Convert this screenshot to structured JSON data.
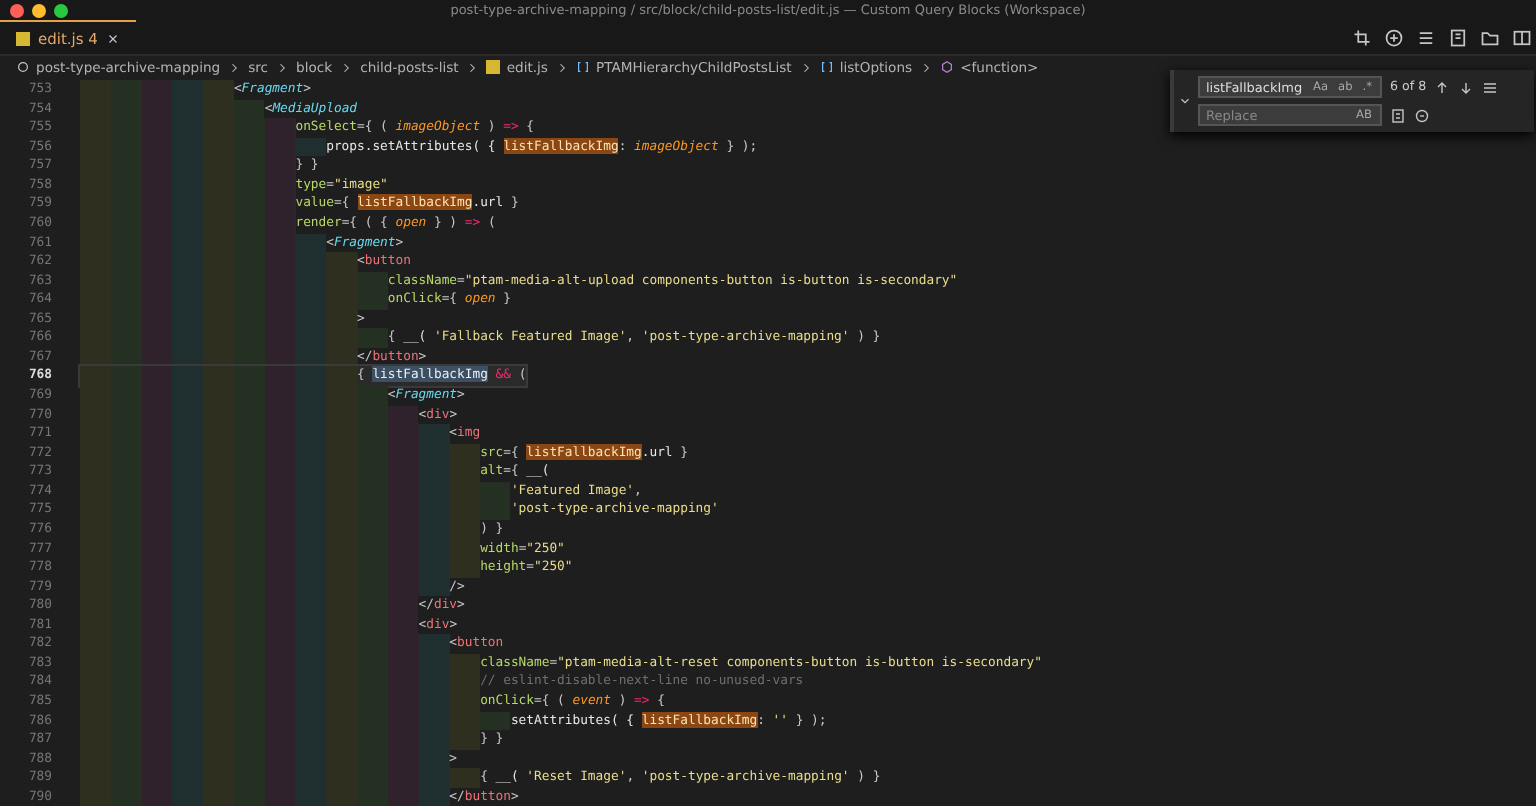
{
  "window": {
    "title": "post-type-archive-mapping / src/block/child-posts-list/edit.js — Custom Query Blocks (Workspace)"
  },
  "tabs": [
    {
      "label": "edit.js",
      "problems": "4",
      "selected": true
    }
  ],
  "breadcrumbs": [
    {
      "kind": "folder",
      "label": "post-type-archive-mapping"
    },
    {
      "kind": "folder",
      "label": "src"
    },
    {
      "kind": "folder",
      "label": "block"
    },
    {
      "kind": "folder",
      "label": "child-posts-list"
    },
    {
      "kind": "file",
      "label": "edit.js"
    },
    {
      "kind": "symbol",
      "label": "PTAMHierarchyChildPostsList"
    },
    {
      "kind": "symbol",
      "label": "listOptions"
    },
    {
      "kind": "function",
      "label": "<function>"
    }
  ],
  "lines": [
    {
      "number": "753",
      "current": false,
      "tokens": [
        {
          "kind": "punct",
          "text": "<"
        },
        {
          "kind": "tag",
          "text": "Fragment"
        },
        {
          "kind": "punct",
          "text": ">"
        }
      ],
      "children": [
        {
          "number": "754",
          "current": false,
          "tokens": [
            {
              "kind": "punct",
              "text": "<"
            },
            {
              "kind": "tag",
              "text": "MediaUpload"
            }
          ],
          "children": [
            {
              "number": "755",
              "current": false,
              "tokens": [
                {
                  "kind": "attr",
                  "text": "onSelect"
                },
                {
                  "kind": "punct",
                  "text": "={ ( "
                },
                {
                  "kind": "param",
                  "text": "imageObject"
                },
                {
                  "kind": "punct",
                  "text": " ) "
                },
                {
                  "kind": "keyword",
                  "text": "=>"
                },
                {
                  "kind": "punct",
                  "text": " {"
                }
              ],
              "children": [
                {
                  "number": "756",
                  "current": false,
                  "tokens": [
                    {
                      "kind": "plain",
                      "text": "props.setAttributes( { "
                    },
                    {
                      "kind": "match",
                      "text": "listFallbackImg"
                    },
                    {
                      "kind": "punct",
                      "text": ": "
                    },
                    {
                      "kind": "param",
                      "text": "imageObject"
                    },
                    {
                      "kind": "punct",
                      "text": " } );"
                    }
                  ]
                }
              ]
            },
            {
              "number": "757",
              "current": false,
              "tokens": [
                {
                  "kind": "punct",
                  "text": "} }"
                }
              ]
            },
            {
              "number": "758",
              "current": false,
              "tokens": [
                {
                  "kind": "attr",
                  "text": "type"
                },
                {
                  "kind": "punct",
                  "text": "="
                },
                {
                  "kind": "string",
                  "text": "\"image\""
                }
              ]
            },
            {
              "number": "759",
              "current": false,
              "tokens": [
                {
                  "kind": "attr",
                  "text": "value"
                },
                {
                  "kind": "punct",
                  "text": "={ "
                },
                {
                  "kind": "match",
                  "text": "listFallbackImg"
                },
                {
                  "kind": "plain",
                  "text": ".url"
                },
                {
                  "kind": "punct",
                  "text": " }"
                }
              ]
            },
            {
              "number": "760",
              "current": false,
              "tokens": [
                {
                  "kind": "attr",
                  "text": "render"
                },
                {
                  "kind": "punct",
                  "text": "={ ( { "
                },
                {
                  "kind": "param",
                  "text": "open"
                },
                {
                  "kind": "punct",
                  "text": " } ) "
                },
                {
                  "kind": "keyword",
                  "text": "=>"
                },
                {
                  "kind": "punct",
                  "text": " ("
                }
              ],
              "children": [
                {
                  "number": "761",
                  "current": false,
                  "tokens": [
                    {
                      "kind": "punct",
                      "text": "<"
                    },
                    {
                      "kind": "tag",
                      "text": "Fragment"
                    },
                    {
                      "kind": "punct",
                      "text": ">"
                    }
                  ],
                  "children": [
                    {
                      "number": "762",
                      "current": false,
                      "tokens": [
                        {
                          "kind": "punct",
                          "text": "<"
                        },
                        {
                          "kind": "element",
                          "text": "button"
                        }
                      ],
                      "children": [
                        {
                          "number": "763",
                          "current": false,
                          "tokens": [
                            {
                              "kind": "attr",
                              "text": "className"
                            },
                            {
                              "kind": "punct",
                              "text": "="
                            },
                            {
                              "kind": "string",
                              "text": "\"ptam-media-alt-upload components-button is-button is-secondary\""
                            }
                          ]
                        },
                        {
                          "number": "764",
                          "current": false,
                          "tokens": [
                            {
                              "kind": "attr",
                              "text": "onClick"
                            },
                            {
                              "kind": "punct",
                              "text": "={ "
                            },
                            {
                              "kind": "param",
                              "text": "open"
                            },
                            {
                              "kind": "punct",
                              "text": " }"
                            }
                          ]
                        }
                      ]
                    },
                    {
                      "number": "765",
                      "current": false,
                      "tokens": [
                        {
                          "kind": "punct",
                          "text": ">"
                        }
                      ],
                      "children": [
                        {
                          "number": "766",
                          "current": false,
                          "tokens": [
                            {
                              "kind": "punct",
                              "text": "{ "
                            },
                            {
                              "kind": "plain",
                              "text": "__( "
                            },
                            {
                              "kind": "string",
                              "text": "'Fallback Featured Image'"
                            },
                            {
                              "kind": "punct",
                              "text": ", "
                            },
                            {
                              "kind": "string",
                              "text": "'post-type-archive-mapping'"
                            },
                            {
                              "kind": "punct",
                              "text": " ) }"
                            }
                          ]
                        }
                      ]
                    },
                    {
                      "number": "767",
                      "current": false,
                      "tokens": [
                        {
                          "kind": "punct",
                          "text": "</"
                        },
                        {
                          "kind": "element",
                          "text": "button"
                        },
                        {
                          "kind": "punct",
                          "text": ">"
                        }
                      ]
                    },
                    {
                      "number": "768",
                      "current": true,
                      "tokens": [
                        {
                          "kind": "punct",
                          "text": "{ "
                        },
                        {
                          "kind": "selection",
                          "text": "listFallbackImg"
                        },
                        {
                          "kind": "keyword",
                          "text": " &&"
                        },
                        {
                          "kind": "punct",
                          "text": " ("
                        }
                      ],
                      "children": [
                        {
                          "number": "769",
                          "current": false,
                          "tokens": [
                            {
                              "kind": "punct",
                              "text": "<"
                            },
                            {
                              "kind": "tag",
                              "text": "Fragment"
                            },
                            {
                              "kind": "punct",
                              "text": ">"
                            }
                          ],
                          "children": [
                            {
                              "number": "770",
                              "current": false,
                              "tokens": [
                                {
                                  "kind": "punct",
                                  "text": "<"
                                },
                                {
                                  "kind": "element",
                                  "text": "div"
                                },
                                {
                                  "kind": "punct",
                                  "text": ">"
                                }
                              ],
                              "children": [
                                {
                                  "number": "771",
                                  "current": false,
                                  "tokens": [
                                    {
                                      "kind": "punct",
                                      "text": "<"
                                    },
                                    {
                                      "kind": "element",
                                      "text": "img"
                                    }
                                  ],
                                  "children": [
                                    {
                                      "number": "772",
                                      "current": false,
                                      "tokens": [
                                        {
                                          "kind": "attr",
                                          "text": "src"
                                        },
                                        {
                                          "kind": "punct",
                                          "text": "={ "
                                        },
                                        {
                                          "kind": "match",
                                          "text": "listFallbackImg"
                                        },
                                        {
                                          "kind": "plain",
                                          "text": ".url"
                                        },
                                        {
                                          "kind": "punct",
                                          "text": " }"
                                        }
                                      ]
                                    },
                                    {
                                      "number": "773",
                                      "current": false,
                                      "tokens": [
                                        {
                                          "kind": "attr",
                                          "text": "alt"
                                        },
                                        {
                                          "kind": "punct",
                                          "text": "={ "
                                        },
                                        {
                                          "kind": "plain",
                                          "text": "__("
                                        }
                                      ],
                                      "children": [
                                        {
                                          "number": "774",
                                          "current": false,
                                          "tokens": [
                                            {
                                              "kind": "string",
                                              "text": "'Featured Image'"
                                            },
                                            {
                                              "kind": "punct",
                                              "text": ","
                                            }
                                          ]
                                        },
                                        {
                                          "number": "775",
                                          "current": false,
                                          "tokens": [
                                            {
                                              "kind": "string",
                                              "text": "'post-type-archive-mapping'"
                                            }
                                          ]
                                        }
                                      ]
                                    },
                                    {
                                      "number": "776",
                                      "current": false,
                                      "tokens": [
                                        {
                                          "kind": "punct",
                                          "text": ") }"
                                        }
                                      ]
                                    },
                                    {
                                      "number": "777",
                                      "current": false,
                                      "tokens": [
                                        {
                                          "kind": "attr",
                                          "text": "width"
                                        },
                                        {
                                          "kind": "punct",
                                          "text": "="
                                        },
                                        {
                                          "kind": "string",
                                          "text": "\"250\""
                                        }
                                      ]
                                    },
                                    {
                                      "number": "778",
                                      "current": false,
                                      "tokens": [
                                        {
                                          "kind": "attr",
                                          "text": "height"
                                        },
                                        {
                                          "kind": "punct",
                                          "text": "="
                                        },
                                        {
                                          "kind": "string",
                                          "text": "\"250\""
                                        }
                                      ]
                                    }
                                  ]
                                },
                                {
                                  "number": "779",
                                  "current": false,
                                  "tokens": [
                                    {
                                      "kind": "punct",
                                      "text": "/>"
                                    }
                                  ]
                                }
                              ]
                            },
                            {
                              "number": "780",
                              "current": false,
                              "tokens": [
                                {
                                  "kind": "punct",
                                  "text": "</"
                                },
                                {
                                  "kind": "element",
                                  "text": "div"
                                },
                                {
                                  "kind": "punct",
                                  "text": ">"
                                }
                              ]
                            },
                            {
                              "number": "781",
                              "current": false,
                              "tokens": [
                                {
                                  "kind": "punct",
                                  "text": "<"
                                },
                                {
                                  "kind": "element",
                                  "text": "div"
                                },
                                {
                                  "kind": "punct",
                                  "text": ">"
                                }
                              ],
                              "children": [
                                {
                                  "number": "782",
                                  "current": false,
                                  "tokens": [
                                    {
                                      "kind": "punct",
                                      "text": "<"
                                    },
                                    {
                                      "kind": "element",
                                      "text": "button"
                                    }
                                  ],
                                  "children": [
                                    {
                                      "number": "783",
                                      "current": false,
                                      "tokens": [
                                        {
                                          "kind": "attr",
                                          "text": "className"
                                        },
                                        {
                                          "kind": "punct",
                                          "text": "="
                                        },
                                        {
                                          "kind": "string",
                                          "text": "\"ptam-media-alt-reset components-button is-button is-secondary\""
                                        }
                                      ]
                                    },
                                    {
                                      "number": "784",
                                      "current": false,
                                      "tokens": [
                                        {
                                          "kind": "comment",
                                          "text": "// eslint-disable-next-line no-unused-vars"
                                        }
                                      ]
                                    },
                                    {
                                      "number": "785",
                                      "current": false,
                                      "tokens": [
                                        {
                                          "kind": "attr",
                                          "text": "onClick"
                                        },
                                        {
                                          "kind": "punct",
                                          "text": "={ ( "
                                        },
                                        {
                                          "kind": "param",
                                          "text": "event"
                                        },
                                        {
                                          "kind": "punct",
                                          "text": " ) "
                                        },
                                        {
                                          "kind": "keyword",
                                          "text": "=>"
                                        },
                                        {
                                          "kind": "punct",
                                          "text": " {"
                                        }
                                      ],
                                      "children": [
                                        {
                                          "number": "786",
                                          "current": false,
                                          "tokens": [
                                            {
                                              "kind": "plain",
                                              "text": "setAttributes( { "
                                            },
                                            {
                                              "kind": "match",
                                              "text": "listFallbackImg"
                                            },
                                            {
                                              "kind": "punct",
                                              "text": ": "
                                            },
                                            {
                                              "kind": "string",
                                              "text": "''"
                                            },
                                            {
                                              "kind": "punct",
                                              "text": " } );"
                                            }
                                          ]
                                        }
                                      ]
                                    },
                                    {
                                      "number": "787",
                                      "current": false,
                                      "tokens": [
                                        {
                                          "kind": "punct",
                                          "text": "} }"
                                        }
                                      ]
                                    }
                                  ]
                                },
                                {
                                  "number": "788",
                                  "current": false,
                                  "tokens": [
                                    {
                                      "kind": "punct",
                                      "text": ">"
                                    }
                                  ],
                                  "children": [
                                    {
                                      "number": "789",
                                      "current": false,
                                      "tokens": [
                                        {
                                          "kind": "punct",
                                          "text": "{ "
                                        },
                                        {
                                          "kind": "plain",
                                          "text": "__( "
                                        },
                                        {
                                          "kind": "string",
                                          "text": "'Reset Image'"
                                        },
                                        {
                                          "kind": "punct",
                                          "text": ", "
                                        },
                                        {
                                          "kind": "string",
                                          "text": "'post-type-archive-mapping'"
                                        },
                                        {
                                          "kind": "punct",
                                          "text": " ) }"
                                        }
                                      ]
                                    }
                                  ]
                                },
                                {
                                  "number": "790",
                                  "current": false,
                                  "tokens": [
                                    {
                                      "kind": "punct",
                                      "text": "</"
                                    },
                                    {
                                      "kind": "element",
                                      "text": "button"
                                    },
                                    {
                                      "kind": "punct",
                                      "text": ">"
                                    }
                                  ]
                                }
                              ]
                            }
                          ]
                        }
                      ]
                    }
                  ]
                }
              ]
            }
          ]
        }
      ]
    }
  ],
  "find": {
    "value": "listFallbackImg",
    "options": [
      {
        "label": "Aa",
        "on": false
      },
      {
        "label": "ab",
        "on": false
      },
      {
        "label": ".*",
        "on": false
      }
    ],
    "result": "6 of 8",
    "replace": {
      "placeholder": "Replace",
      "preserve_case": "AB"
    }
  }
}
